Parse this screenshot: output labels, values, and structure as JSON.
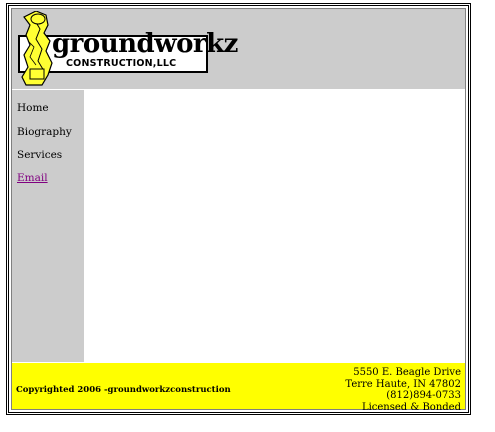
{
  "logo": {
    "word": "groundworkz",
    "subline": "CONSTRUCTION,LLC"
  },
  "nav": {
    "items": [
      {
        "label": "Home"
      },
      {
        "label": "Biography"
      },
      {
        "label": "Services"
      },
      {
        "label": "Email"
      }
    ]
  },
  "footer": {
    "copyright": "Copyrighted 2006 -groundworkzconstruction",
    "address_line1": "5550 E. Beagle Drive",
    "address_line2": "Terre Haute, IN 47802",
    "phone": "(812)894-0733",
    "license": "Licensed & Bonded"
  },
  "colors": {
    "header_bg": "#cccccc",
    "sidebar_bg": "#cccccc",
    "footer_bg": "#ffff00",
    "visited_link": "#800080"
  }
}
